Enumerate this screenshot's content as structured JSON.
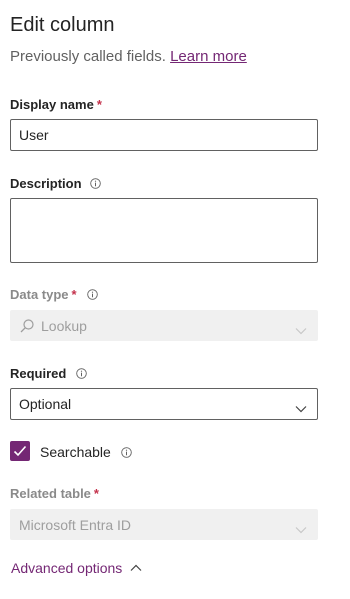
{
  "header": {
    "title": "Edit column",
    "subtitle": "Previously called fields.",
    "learn_more": "Learn more"
  },
  "display_name": {
    "label": "Display name",
    "required_mark": "*",
    "value": "User"
  },
  "description": {
    "label": "Description",
    "value": ""
  },
  "data_type": {
    "label": "Data type",
    "required_mark": "*",
    "value": "Lookup",
    "icon": "search-icon"
  },
  "required": {
    "label": "Required",
    "value": "Optional"
  },
  "searchable": {
    "label": "Searchable",
    "checked": true
  },
  "related_table": {
    "label": "Related table",
    "required_mark": "*",
    "value": "Microsoft Entra ID"
  },
  "advanced": {
    "label": "Advanced options"
  },
  "colors": {
    "accent": "#742774",
    "required": "#c4314b",
    "disabled_bg": "#f0f0f0"
  }
}
